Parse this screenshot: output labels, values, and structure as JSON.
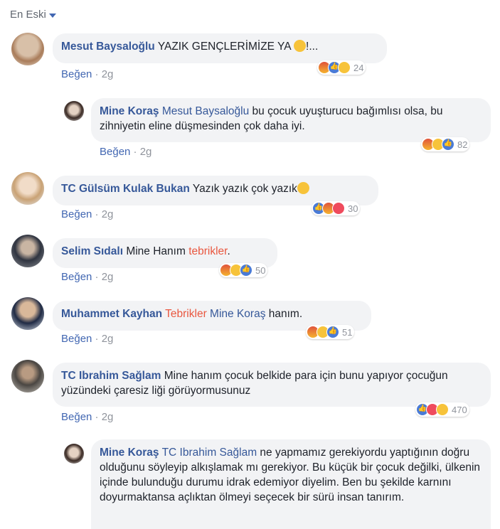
{
  "sort_label": "En Eski",
  "like_label": "Beğen",
  "sep": "·",
  "comments": [
    {
      "author": "Mesut Baysaloğlu",
      "text": "YAZIK GENÇLERİMİZE YA",
      "tail": "!...",
      "time": "2g",
      "reactions": "24"
    },
    {
      "author": "Mine Koraş",
      "mention": "Mesut Baysaloğlu",
      "text": " bu çocuk uyuşturucu bağımlısı olsa, bu zihniyetin eline düşmesinden çok daha iyi.",
      "time": "2g",
      "reactions": "82"
    },
    {
      "author": "TC Gülsüm Kulak Bukan",
      "text": "Yazık yazık çok yazık",
      "time": "2g",
      "reactions": "30"
    },
    {
      "author": "Selim Sıdalı",
      "text": "Mine Hanım ",
      "highlight": "tebrikler",
      "tail": ".",
      "time": "2g",
      "reactions": "50"
    },
    {
      "author": "Muhammet Kayhan",
      "highlight": "Tebrikler",
      "mention": "Mine Koraş",
      "text": " hanım.",
      "time": "2g",
      "reactions": "51"
    },
    {
      "author": "TC Ibrahim Sağlam",
      "text": "Mine hanım çocuk belkide para için bunu yapıyor çocuğun yüzündeki çaresiz liği görüyormusunuz",
      "time": "2g",
      "reactions": "470"
    },
    {
      "author": "Mine Koraş",
      "mention": "TC Ibrahim Sağlam",
      "text": " ne yapmamız gerekiyordu yaptığının doğru olduğunu söyleyip alkışlamak mı gerekiyor. Bu küçük bir çocuk değilki, ülkenin içinde bulunduğu durumu idrak edemiyor diyelim. Ben bu şekilde karnını doyurmaktansa açlıktan ölmeyi seçecek bir sürü insan tanırım."
    }
  ]
}
